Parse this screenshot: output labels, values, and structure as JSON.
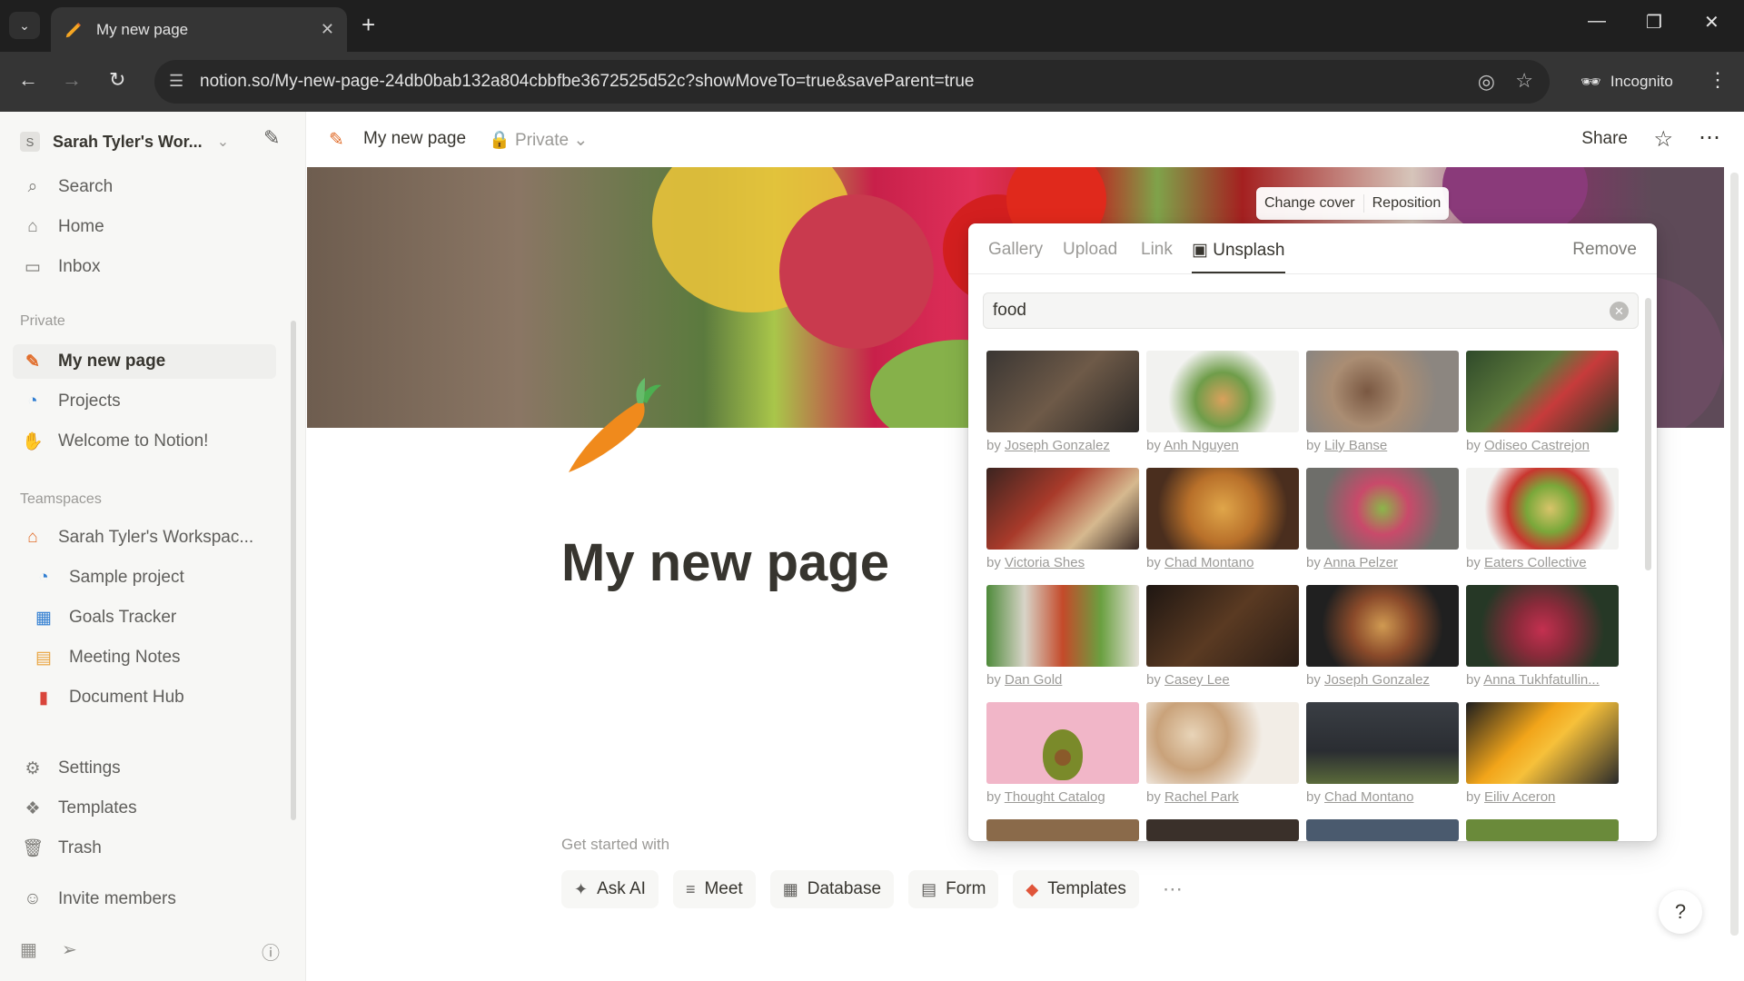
{
  "browser": {
    "tab_title": "My new page",
    "url": "notion.so/My-new-page-24db0bab132a804cbbfbe3672525d52c?showMoveTo=true&saveParent=true",
    "incognito_label": "Incognito"
  },
  "sidebar": {
    "workspace_name": "Sarah Tyler's Wor...",
    "workspace_initial": "S",
    "top_items": [
      {
        "label": "Search",
        "icon": "search-icon"
      },
      {
        "label": "Home",
        "icon": "home-icon"
      },
      {
        "label": "Inbox",
        "icon": "inbox-icon"
      }
    ],
    "private_label": "Private",
    "private_items": [
      {
        "label": "My new page",
        "icon": "pencil-icon"
      },
      {
        "label": "Projects",
        "icon": "projects-icon"
      },
      {
        "label": "Welcome to Notion!",
        "icon": "wave-icon"
      }
    ],
    "teamspaces_label": "Teamspaces",
    "teamspace_name": "Sarah Tyler's Workspac...",
    "teamspace_items": [
      {
        "label": "Sample project",
        "icon": "projects-icon"
      },
      {
        "label": "Goals Tracker",
        "icon": "chart-icon"
      },
      {
        "label": "Meeting Notes",
        "icon": "calendar-icon"
      },
      {
        "label": "Document Hub",
        "icon": "document-icon"
      }
    ],
    "bottom_items": [
      {
        "label": "Settings",
        "icon": "gear-icon"
      },
      {
        "label": "Templates",
        "icon": "templates-icon"
      },
      {
        "label": "Trash",
        "icon": "trash-icon"
      }
    ],
    "invite_label": "Invite members"
  },
  "topbar": {
    "page_title": "My new page",
    "privacy": "Private",
    "share": "Share"
  },
  "page": {
    "title": "My new page"
  },
  "cover_menu": {
    "change_cover": "Change cover",
    "reposition": "Reposition"
  },
  "picker": {
    "tabs": [
      "Gallery",
      "Upload",
      "Link",
      "Unsplash"
    ],
    "active_tab": "Unsplash",
    "remove": "Remove",
    "search_value": "food",
    "photos": [
      {
        "by": "by",
        "author": "Joseph Gonzalez"
      },
      {
        "by": "by",
        "author": "Anh Nguyen"
      },
      {
        "by": "by",
        "author": "Lily Banse"
      },
      {
        "by": "by",
        "author": "Odiseo Castrejon"
      },
      {
        "by": "by",
        "author": "Victoria Shes"
      },
      {
        "by": "by",
        "author": "Chad Montano"
      },
      {
        "by": "by",
        "author": "Anna Pelzer"
      },
      {
        "by": "by",
        "author": "Eaters Collective"
      },
      {
        "by": "by",
        "author": "Dan Gold"
      },
      {
        "by": "by",
        "author": "Casey Lee"
      },
      {
        "by": "by",
        "author": "Joseph Gonzalez"
      },
      {
        "by": "by",
        "author": "Anna Tukhfatullin..."
      },
      {
        "by": "by",
        "author": "Thought Catalog"
      },
      {
        "by": "by",
        "author": "Rachel Park"
      },
      {
        "by": "by",
        "author": "Chad Montano"
      },
      {
        "by": "by",
        "author": "Eiliv Aceron"
      }
    ]
  },
  "get_started": {
    "label": "Get started with",
    "buttons": [
      {
        "label": "Ask AI",
        "icon": "ai-icon"
      },
      {
        "label": "Meet",
        "icon": "meet-icon"
      },
      {
        "label": "Database",
        "icon": "table-icon"
      },
      {
        "label": "Form",
        "icon": "form-icon"
      },
      {
        "label": "Templates",
        "icon": "templates-icon"
      }
    ]
  },
  "colors": {
    "sidebar_bg": "#f7f7f5",
    "text": "#37352f",
    "muted": "#9b9a97"
  }
}
